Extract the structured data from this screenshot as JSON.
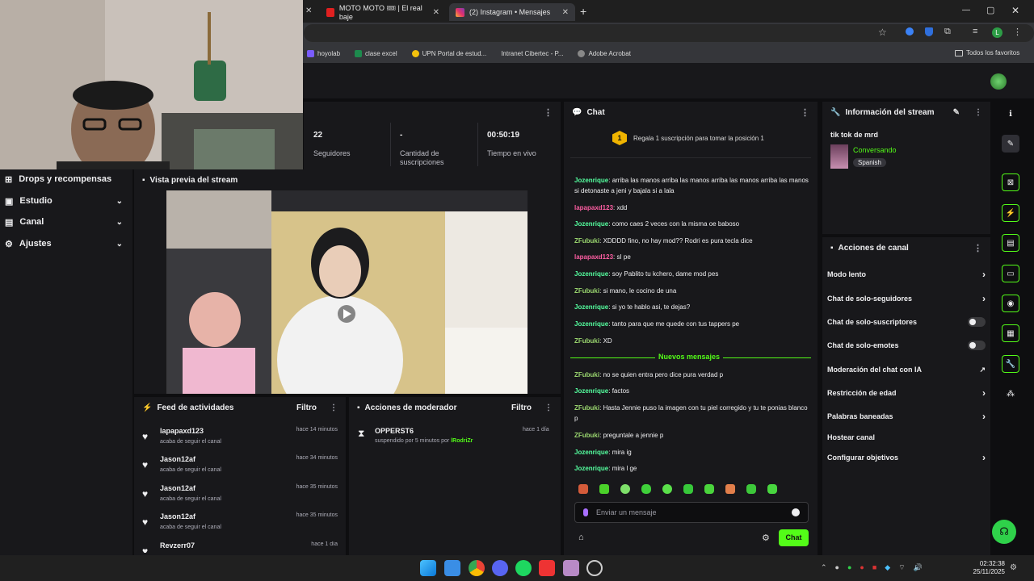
{
  "browser": {
    "tabs": [
      {
        "title": "MOTO MOTO 🎟 | El real baje",
        "close": "✕"
      },
      {
        "title": "(2) Instagram • Mensajes",
        "close": "✕"
      }
    ],
    "new_tab": "+",
    "first_tab_close": "✕",
    "window_controls": [
      "—",
      "▢",
      "✕"
    ],
    "bookmarks": [
      "hoyolab",
      "clase excel",
      "UPN Portal de estud...",
      "Intranet Cibertec - P...",
      "Adobe Acrobat"
    ],
    "all_favorites": "Todos los favoritos",
    "profile_initial": "L"
  },
  "stats": {
    "followers_value": "22",
    "followers_label": "Seguidores",
    "subs_value": "-",
    "subs_label": "Cantidad de suscripciones",
    "live_value": "00:50:19",
    "live_label": "Tiempo en vivo"
  },
  "nav": [
    {
      "label": "Drops y recompensas",
      "chev": ""
    },
    {
      "label": "Estudio",
      "chev": "⌄"
    },
    {
      "label": "Canal",
      "chev": "⌄"
    },
    {
      "label": "Ajustes",
      "chev": "⌄"
    }
  ],
  "preview": {
    "title": "Vista previa del stream"
  },
  "activity_feed": {
    "title": "Feed de actividades",
    "filter": "Filtro",
    "items": [
      {
        "name": "lapapaxd123",
        "desc": "acaba de seguir el canal",
        "time": "hace 14 minutos"
      },
      {
        "name": "Jason12af",
        "desc": "acaba de seguir el canal",
        "time": "hace 34 minutos"
      },
      {
        "name": "Jason12af",
        "desc": "acaba de seguir el canal",
        "time": "hace 35 minutos"
      },
      {
        "name": "Jason12af",
        "desc": "acaba de seguir el canal",
        "time": "hace 35 minutos"
      },
      {
        "name": "Revzerr07",
        "desc": "",
        "time": "hace 1 día"
      }
    ]
  },
  "mod_actions": {
    "title": "Acciones de moderador",
    "filter": "Filtro",
    "item": {
      "name": "OPPERST6",
      "desc": "suspendido por 5 minutos por",
      "by": "lRodriZr",
      "time": "hace 1 día"
    }
  },
  "chat": {
    "title": "Chat",
    "hype_rank": "1",
    "hype_text": "Regala 1 suscripción para tomar la posición 1",
    "messages": [
      {
        "user": "Jozenrique",
        "cls": "u1",
        "text": "arriba las manos arriba las manos arriba las manos arriba las manos si detonaste a jeni y bajala si a lala"
      },
      {
        "user": "lapapaxd123",
        "cls": "u2",
        "text": "xdd"
      },
      {
        "user": "Jozenrique",
        "cls": "u1",
        "text": "como caes 2 veces con la misma oe baboso"
      },
      {
        "user": "ZFubuki",
        "cls": "u3",
        "text": "XDDDD fino, no hay mod?? Rodri es pura tecla dice"
      },
      {
        "user": "lapapaxd123",
        "cls": "u2",
        "text": "sI pe"
      },
      {
        "user": "Jozenrique",
        "cls": "u1",
        "text": "soy Pablito tu kchero, dame mod pes"
      },
      {
        "user": "ZFubuki",
        "cls": "u3",
        "text": "si mano, le cocino de una"
      },
      {
        "user": "Jozenrique",
        "cls": "u1",
        "text": "si yo te hablo asi, te dejas?"
      },
      {
        "user": "Jozenrique",
        "cls": "u1",
        "text": "tanto para que me quede con tus tappers pe"
      },
      {
        "user": "ZFubuki",
        "cls": "u3",
        "text": "XD"
      }
    ],
    "new_messages": "Nuevos mensajes",
    "new": [
      {
        "user": "ZFubuki",
        "cls": "u3",
        "text": "no se quien entra pero dice pura verdad p"
      },
      {
        "user": "Jozenrique",
        "cls": "u1",
        "text": "factos"
      },
      {
        "user": "ZFubuki",
        "cls": "u3",
        "text": "Hasta Jennie puso la imagen con tu piel corregido y tu te ponias blanco p"
      },
      {
        "user": "ZFubuki",
        "cls": "u3",
        "text": "preguntale a jennie p"
      },
      {
        "user": "Jozenrique",
        "cls": "u1",
        "text": "mira ig"
      },
      {
        "user": "Jozenrique",
        "cls": "u1",
        "text": "mira l ge"
      }
    ],
    "placeholder": "Enviar un mensaje",
    "send": "Chat"
  },
  "stream_info": {
    "title": "Información del stream",
    "stream_title": "tik tok de mrd",
    "category": "Conversando",
    "tag": "Spanish"
  },
  "channel_actions": {
    "title": "Acciones de canal",
    "items": [
      {
        "label": "Modo lento",
        "kind": "chev"
      },
      {
        "label": "Chat de solo-seguidores",
        "kind": "chev"
      },
      {
        "label": "Chat de solo-suscriptores",
        "kind": "toggle"
      },
      {
        "label": "Chat de solo-emotes",
        "kind": "toggle"
      },
      {
        "label": "Moderación del chat con IA",
        "kind": "ext"
      },
      {
        "label": "Restricción de edad",
        "kind": "chev"
      },
      {
        "label": "Palabras baneadas",
        "kind": "chev"
      },
      {
        "label": "Hostear canal",
        "kind": "none"
      },
      {
        "label": "Configurar objetivos",
        "kind": "chev"
      }
    ]
  },
  "taskbar": {
    "time": "02:32:38",
    "date": "25/11/2025"
  },
  "colors": {
    "accent": "#53fc18",
    "bg": "#0e0e10",
    "panel": "#18181b"
  }
}
